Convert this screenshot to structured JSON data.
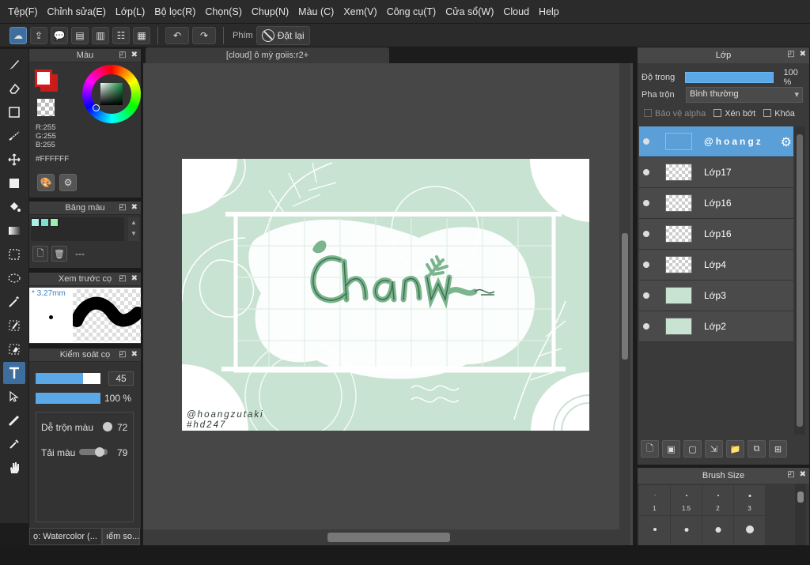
{
  "menu": [
    "Tệp(F)",
    "Chỉnh sửa(E)",
    "Lớp(L)",
    "Bộ lọc(R)",
    "Chọn(S)",
    "Chụp(N)",
    "Màu (C)",
    "Xem(V)",
    "Công cụ(T)",
    "Cửa sổ(W)",
    "Cloud",
    "Help"
  ],
  "toolbar": {
    "shortcut_label": "Phím",
    "reset_label": "Đặt lại"
  },
  "color_panel": {
    "title": "Màu",
    "r": "R:255",
    "g": "G:255",
    "b": "B:255",
    "hex": "#FFFFFF",
    "front_color": "#ffffff",
    "back_color": "#c71c1c"
  },
  "palette_panel": {
    "title": "Bảng màu",
    "swatches": [
      "#a8f0e8",
      "#7ee0d0",
      "#9ef0b0"
    ],
    "palette_name": "---"
  },
  "preview_panel": {
    "title": "Xem trước cọ",
    "size": "* 3.27mm"
  },
  "brush_control": {
    "title": "Kiểm soát cọ",
    "size_value": "45",
    "opacity_value": "100 %",
    "blend_label": "Dễ trộn màu",
    "blend_value": "72",
    "pick_label": "Tải màu",
    "pick_value": "79"
  },
  "brush_tabs": [
    "ọ: Watercolor (...",
    "ıểm so..."
  ],
  "document": {
    "tab_title": "[cloud] ô mỳ goiis:r2+",
    "signature_line1": "@hoangzutaki",
    "signature_line2": "#hd247"
  },
  "layer_panel": {
    "title": "Lớp",
    "opacity_label": "Độ trong",
    "opacity_value": "100 %",
    "blend_label": "Pha trộn",
    "blend_value": "Bình thường",
    "protect_alpha": "Bảo vệ alpha",
    "clipping": "Xén bớt",
    "lock": "Khóa",
    "layers": [
      {
        "name": "@hoangz",
        "selected": true
      },
      {
        "name": "Lớp17"
      },
      {
        "name": "Lớp16"
      },
      {
        "name": "Lớp16"
      },
      {
        "name": "Lớp4"
      },
      {
        "name": "Lớp3"
      },
      {
        "name": "Lớp2"
      }
    ]
  },
  "brush_size": {
    "title": "Brush Size",
    "labels": [
      "1",
      "1.5",
      "2",
      "3"
    ]
  }
}
